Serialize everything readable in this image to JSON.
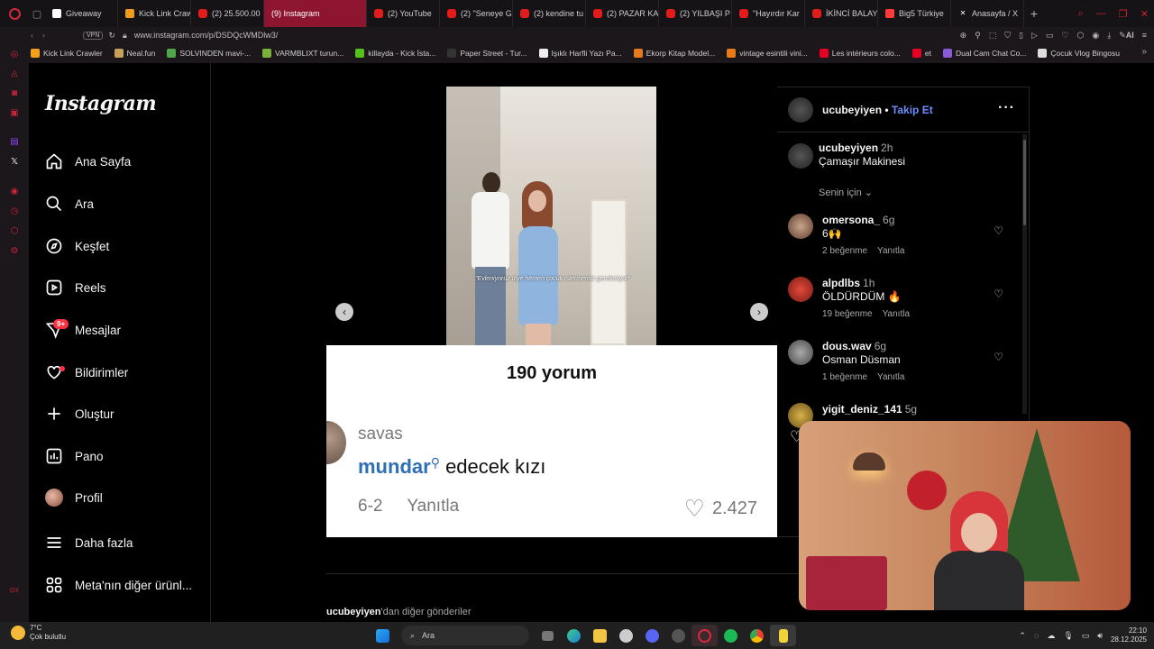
{
  "browser": {
    "tabs": [
      {
        "label": "Giveaway",
        "icon": "globe-icon"
      },
      {
        "label": "Kick Link Craw",
        "icon": "kick-icon"
      },
      {
        "label": "(2) 25.500.00",
        "icon": "youtube-icon"
      },
      {
        "label": "(9) Instagram",
        "icon": "instagram-icon",
        "active": true
      },
      {
        "label": "(2) YouTube",
        "icon": "youtube-icon"
      },
      {
        "label": "(2) \"Seneye G",
        "icon": "youtube-icon"
      },
      {
        "label": "(2) kendine tu",
        "icon": "youtube-icon"
      },
      {
        "label": "(2) PAZAR KA",
        "icon": "youtube-icon"
      },
      {
        "label": "(2) YILBAŞI P",
        "icon": "youtube-icon"
      },
      {
        "label": "\"Hayırdır Kar",
        "icon": "youtube-icon"
      },
      {
        "label": "İKİNCİ BALAY",
        "icon": "youtube-icon"
      },
      {
        "label": "Big5 Türkiye",
        "icon": "big5-icon"
      },
      {
        "label": "Anasayfa / X",
        "icon": "x-icon"
      }
    ],
    "url": "www.instagram.com/p/DSDQcWMDlw3/",
    "vpn_label": "VPN",
    "ai_label": "AI",
    "bookmarks": [
      {
        "label": "Kick Link Crawler",
        "color": "#f2a21a"
      },
      {
        "label": "Neal.fun",
        "color": "#c8a05a"
      },
      {
        "label": "SOLVINDEN mavi-...",
        "color": "#4ea84a"
      },
      {
        "label": "VARMBLIXT turun...",
        "color": "#7ab33a"
      },
      {
        "label": "killayda - Kick İsta...",
        "color": "#53c21a"
      },
      {
        "label": "Paper Street - Tur...",
        "color": "#333333"
      },
      {
        "label": "Işıklı Harfli Yazı Pa...",
        "color": "#eeeeee"
      },
      {
        "label": "Ekorp Kitap Model...",
        "color": "#e67a1a"
      },
      {
        "label": "vintage esintili vini...",
        "color": "#e67a1a"
      },
      {
        "label": "Les intérieurs colo...",
        "color": "#e60023"
      },
      {
        "label": "et",
        "color": "#e60023"
      },
      {
        "label": "Dual Cam Chat Co...",
        "color": "#8a5ad8"
      },
      {
        "label": "Çocuk Vlog Bingosu",
        "color": "#dddddd"
      }
    ]
  },
  "instagram": {
    "logo": "Instagram",
    "nav": [
      {
        "label": "Ana Sayfa",
        "icon": "home-icon"
      },
      {
        "label": "Ara",
        "icon": "search-icon"
      },
      {
        "label": "Keşfet",
        "icon": "compass-icon"
      },
      {
        "label": "Reels",
        "icon": "reels-icon"
      },
      {
        "label": "Mesajlar",
        "icon": "messenger-icon",
        "badge": "9+"
      },
      {
        "label": "Bildirimler",
        "icon": "heart-icon"
      },
      {
        "label": "Oluştur",
        "icon": "plus-icon"
      },
      {
        "label": "Pano",
        "icon": "dashboard-icon"
      },
      {
        "label": "Profil",
        "icon": "profile-avatar"
      },
      {
        "label": "Daha fazla",
        "icon": "menu-icon"
      },
      {
        "label": "Meta'nın diğer ürünl...",
        "icon": "meta-apps-icon"
      }
    ],
    "post": {
      "video_subtitle": "\"Evleniyoruz diye hemen çocuk istermemiz gerekmiyor\"",
      "card": {
        "count": "190 yorum",
        "user": "savas",
        "mention": "mundar",
        "text": " edecek kızı",
        "time": "6-2",
        "reply": "Yanıtla",
        "likes": "2.427"
      }
    },
    "panel": {
      "author": "ucubeyiyen",
      "separator": "•",
      "follow": "Takip Et",
      "caption_user": "ucubeyiyen",
      "caption_time": "2h",
      "caption": "Çamaşır Makinesi",
      "sort": "Senin için",
      "comments": [
        {
          "user": "omersona_",
          "time": "6g",
          "text": "6🙌",
          "likes": "2 beğenme",
          "reply": "Yanıtla"
        },
        {
          "user": "alpdlbs",
          "time": "1h",
          "text": "ÖLDÜRDÜM 🔥",
          "likes": "19 beğenme",
          "reply": "Yanıtla"
        },
        {
          "user": "dous.wav",
          "time": "6g",
          "text": "Osman Düsman",
          "likes": "1 beğenme",
          "reply": "Yanıtla"
        },
        {
          "user": "yigit_deniz_141",
          "time": "5g",
          "text": "",
          "likes": "",
          "reply": ""
        }
      ]
    },
    "more_posts": {
      "user": "ucubeyiyen",
      "suffix": "'dan diğer gönderiler"
    }
  },
  "taskbar": {
    "weather_temp": "7°C",
    "weather_desc": "Çok bulutlu",
    "search_placeholder": "Ara",
    "time": "22:10",
    "date": "28.12.2025"
  }
}
